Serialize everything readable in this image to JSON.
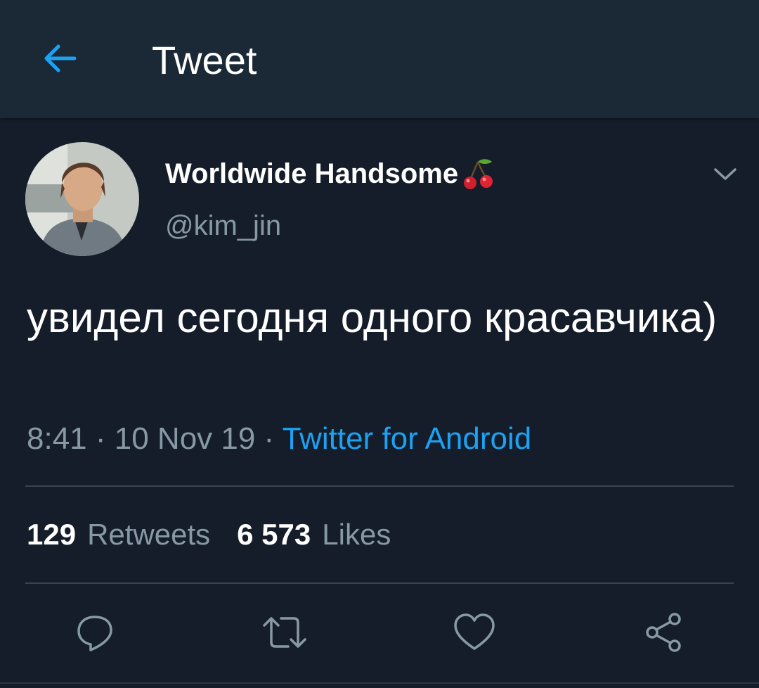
{
  "header": {
    "back_icon": "arrow-left-icon",
    "title": "Tweet"
  },
  "tweet": {
    "author": {
      "display_name": "Worldwide Handsome",
      "name_emoji": "cherries-icon",
      "handle": "@kim_jin"
    },
    "text": "увидел сегодня одного красавчика)",
    "meta": {
      "time": "8:41",
      "separator": " · ",
      "date": "10 Nov 19",
      "source": "Twitter for Android"
    },
    "stats": {
      "retweets_count": "129",
      "retweets_label": "Retweets",
      "likes_count": "6 573",
      "likes_label": "Likes"
    },
    "actions": [
      "reply-icon",
      "retweet-icon",
      "like-icon",
      "share-icon"
    ]
  },
  "colors": {
    "background": "#141d29",
    "header": "#1b2836",
    "accent": "#1da1f2",
    "secondary_text": "#8899a6",
    "divider": "#38444d"
  }
}
